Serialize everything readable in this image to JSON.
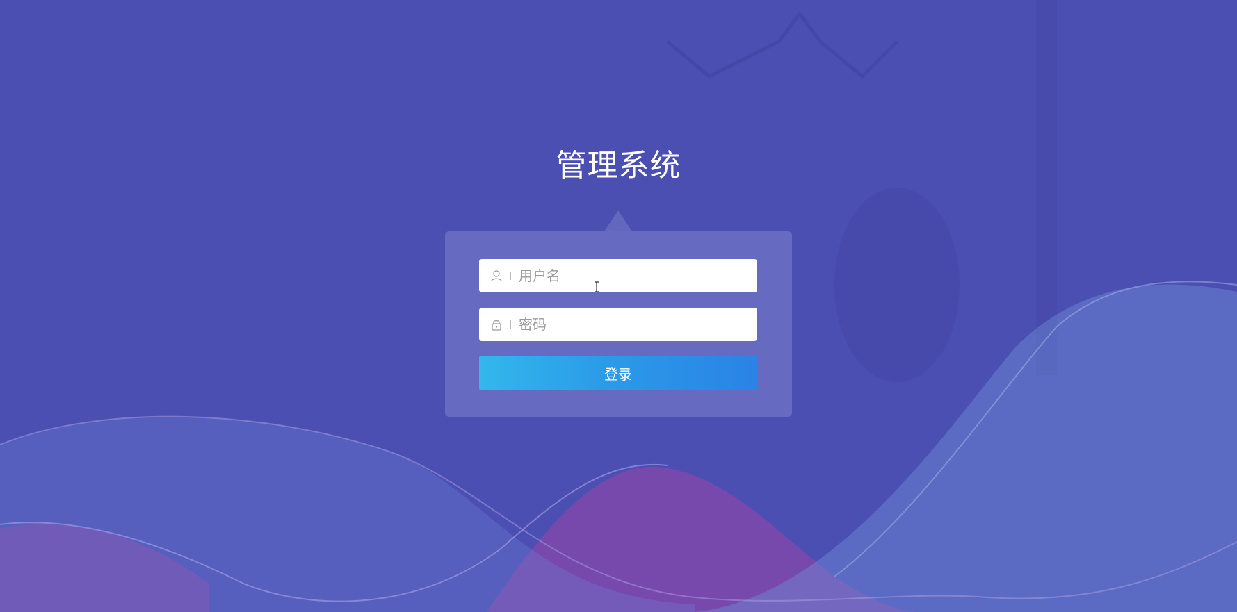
{
  "title": "管理系统",
  "form": {
    "username": {
      "placeholder": "用户名",
      "value": "",
      "icon": "user-icon"
    },
    "password": {
      "placeholder": "密码",
      "value": "",
      "icon": "lock-icon"
    },
    "login_label": "登录"
  },
  "colors": {
    "background": "#4b4fb2",
    "panel": "rgba(125,130,205,0.55)",
    "button_start": "#33b7ec",
    "button_end": "#2a83e6",
    "wave_purple": "#8a4aa8"
  }
}
